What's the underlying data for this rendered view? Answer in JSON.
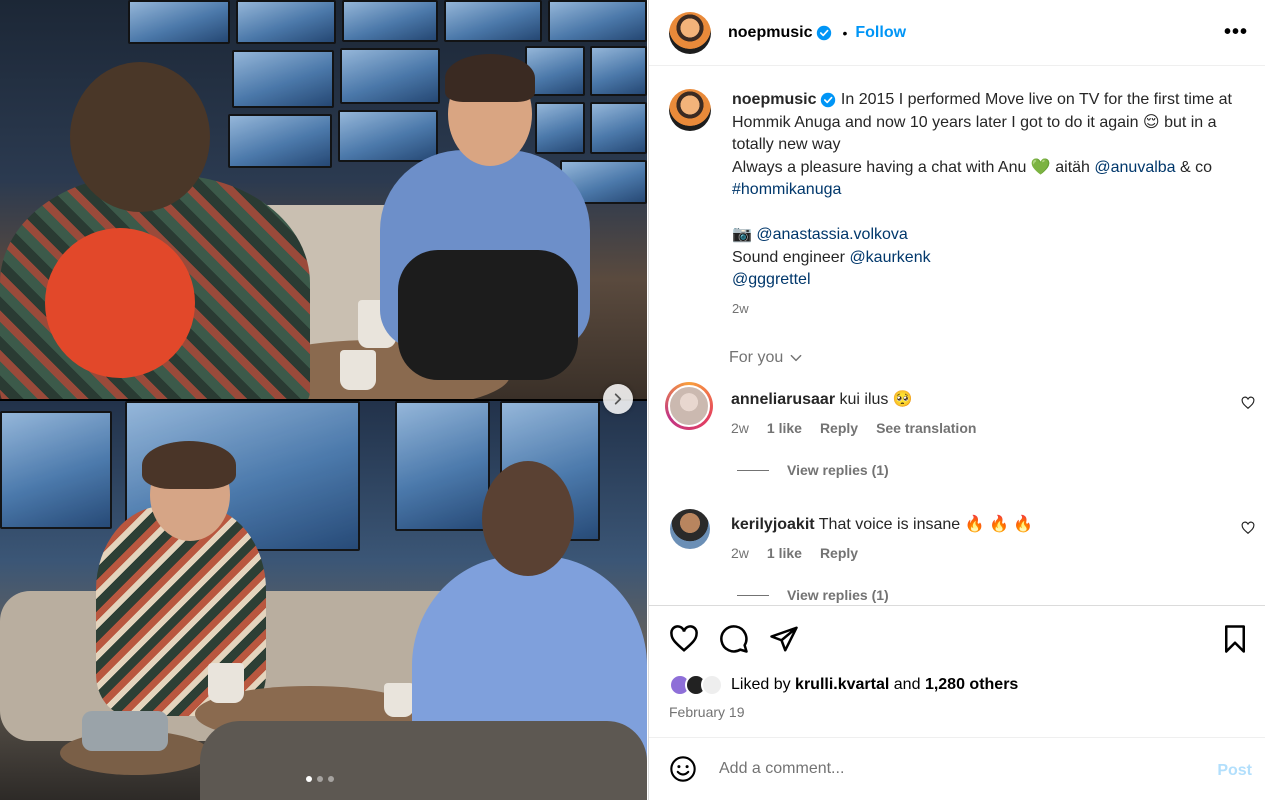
{
  "colors": {
    "accent": "#0095f6",
    "link": "#00376b",
    "muted": "#737373",
    "post_disabled": "#b2dffc",
    "verified": "#0095f6",
    "heart_green": "#2ecc71",
    "fire": "#f5811f"
  },
  "media": {
    "carousel_dots": 3,
    "active_dot": 1,
    "next_icon": "chevron-right-icon"
  },
  "header": {
    "username": "noepmusic",
    "separator": "•",
    "follow_label": "Follow",
    "more_label": "•••"
  },
  "caption": {
    "username": "noepmusic",
    "line1": "In 2015 I performed Move live on TV for the first time at Hommik Anuga and now 10 years later I got to do it again",
    "line1_emoji": "😌",
    "line1_tail": "but in a totally new way",
    "line2_prefix": "Always a pleasure having a chat with Anu",
    "line2_emoji": "💚",
    "line2_mid": "aitäh",
    "mention_anu": "@anuvalba",
    "amp": "&",
    "co": "co",
    "hashtag": "#hommikanuga",
    "camera_emoji": "📷",
    "mention_photo": "@anastassia.volkova",
    "sound_label": "Sound engineer",
    "mention_sound": "@kaurkenk",
    "mention_gg": "@gggrettel",
    "time": "2w"
  },
  "for_you": {
    "label": "For you",
    "icon": "chevron-down-icon"
  },
  "comments": [
    {
      "username": "anneliarusaar",
      "text": "kui ilus",
      "emoji": "🥺",
      "time": "2w",
      "likes": "1 like",
      "reply": "Reply",
      "translate": "See translation",
      "view_replies": "View replies (1)"
    },
    {
      "username": "kerilyjoakit",
      "text": "That voice is insane",
      "emoji": "🔥 🔥 🔥",
      "time": "2w",
      "likes": "1 like",
      "reply": "Reply",
      "view_replies": "View replies (1)"
    }
  ],
  "actions": {
    "like_icon": "heart-icon",
    "comment_icon": "comment-icon",
    "share_icon": "share-icon",
    "save_icon": "bookmark-icon"
  },
  "likes": {
    "prefix": "Liked by",
    "user": "krulli.kvartal",
    "and": "and",
    "others": "1,280 others"
  },
  "date": "February 19",
  "comment_bar": {
    "placeholder": "Add a comment...",
    "post_label": "Post",
    "emoji_icon": "smiley-icon"
  }
}
